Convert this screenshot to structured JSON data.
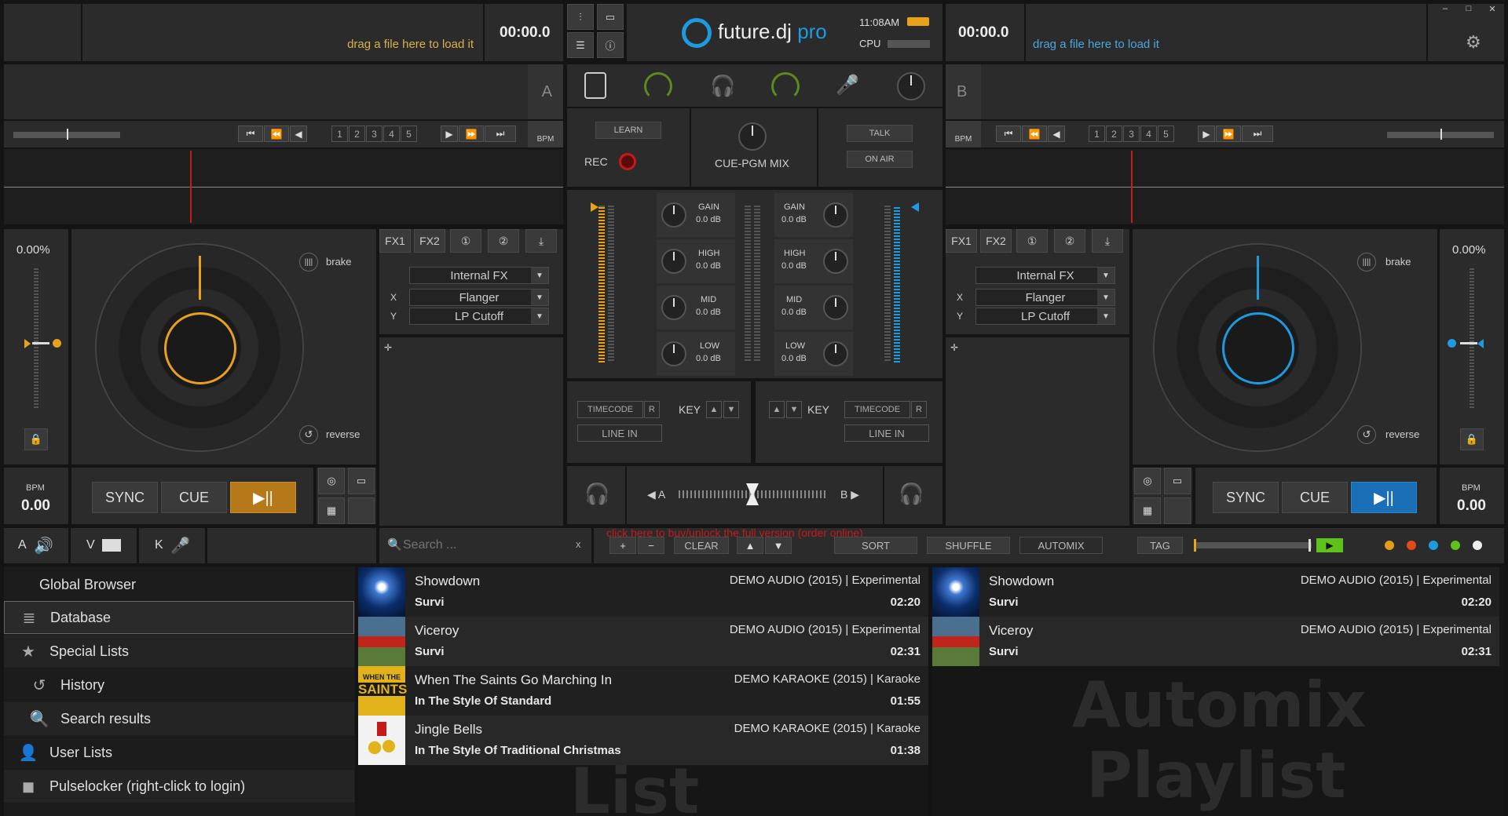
{
  "app": {
    "name": "future.dj",
    "suffix": "pro",
    "clock": "11:08AM",
    "cpu_label": "CPU"
  },
  "window": {
    "minimize": "–",
    "maximize": "□",
    "close": "✕"
  },
  "deckA": {
    "letter": "A",
    "time": "00:00.0",
    "drag_hint": "drag a file here to load it",
    "pitch": "0.00%",
    "bpm_label": "BPM",
    "bpm_value": "0.00",
    "sync": "SYNC",
    "cue": "CUE",
    "play": "▶||",
    "brake": "brake",
    "reverse": "reverse",
    "bpm_btn": "BPM",
    "hotcues": [
      "1",
      "2",
      "3",
      "4",
      "5"
    ],
    "fx1": "FX1",
    "fx2": "FX2",
    "fx_slot": "Internal FX",
    "fx_x_label": "X",
    "fx_x_value": "Flanger",
    "fx_y_label": "Y",
    "fx_y_value": "LP Cutoff",
    "accent": "#e7a21a"
  },
  "deckB": {
    "letter": "B",
    "time": "00:00.0",
    "drag_hint": "drag a file here to load it",
    "pitch": "0.00%",
    "bpm_label": "BPM",
    "bpm_value": "0.00",
    "sync": "SYNC",
    "cue": "CUE",
    "play": "▶||",
    "brake": "brake",
    "reverse": "reverse",
    "bpm_btn": "BPM",
    "hotcues": [
      "1",
      "2",
      "3",
      "4",
      "5"
    ],
    "fx1": "FX1",
    "fx2": "FX2",
    "fx_slot": "Internal FX",
    "fx_x_label": "X",
    "fx_x_value": "Flanger",
    "fx_y_label": "Y",
    "fx_y_value": "LP Cutoff",
    "accent": "#1e9ae0"
  },
  "mixer": {
    "learn": "LEARN",
    "rec": "REC",
    "cue_pgm": "CUE-PGM MIX",
    "talk": "TALK",
    "on_air": "ON AIR",
    "eq_left": [
      {
        "label": "GAIN",
        "value": "0.0 dB"
      },
      {
        "label": "HIGH",
        "value": "0.0 dB"
      },
      {
        "label": "MID",
        "value": "0.0 dB"
      },
      {
        "label": "LOW",
        "value": "0.0 dB"
      }
    ],
    "eq_right": [
      {
        "label": "GAIN",
        "value": "0.0 dB"
      },
      {
        "label": "HIGH",
        "value": "0.0 dB"
      },
      {
        "label": "MID",
        "value": "0.0 dB"
      },
      {
        "label": "LOW",
        "value": "0.0 dB"
      }
    ],
    "timecode": "TIMECODE",
    "r": "R",
    "key": "KEY",
    "line_in": "LINE IN",
    "xfade_a": "◀ A",
    "xfade_b": "B ▶"
  },
  "browser_bar": {
    "tab_a": "A",
    "tab_v": "V",
    "tab_k": "K",
    "search_placeholder": "Search ...",
    "search_clear": "x",
    "plus": "+",
    "minus": "−",
    "clear": "CLEAR",
    "up": "▲",
    "down": "▼",
    "sort": "SORT",
    "shuffle": "SHUFFLE",
    "automix": "AUTOMIX",
    "tag": "TAG",
    "promo": "click here to buy/unlock the full version (order online)",
    "color_dots": [
      "#e79a1a",
      "#e24a1a",
      "#1e9ae0",
      "#5fc21a",
      "#eeeeee"
    ]
  },
  "sidebar": {
    "items": [
      {
        "label": "Global Browser"
      },
      {
        "label": "Database"
      },
      {
        "label": "Special Lists"
      },
      {
        "label": "History"
      },
      {
        "label": "Search results"
      },
      {
        "label": "User Lists"
      },
      {
        "label": "Pulselocker (right-click to login)"
      }
    ]
  },
  "list": {
    "watermark": "List",
    "tracks": [
      {
        "title": "Showdown",
        "artist": "Survi",
        "meta": "DEMO AUDIO (2015) | Experimental",
        "duration": "02:20"
      },
      {
        "title": "Viceroy",
        "artist": "Survi",
        "meta": "DEMO AUDIO (2015) | Experimental",
        "duration": "02:31"
      },
      {
        "title": "When The Saints Go Marching In",
        "artist": "In The Style Of Standard",
        "meta": "DEMO KARAOKE (2015) | Karaoke",
        "duration": "01:55"
      },
      {
        "title": "Jingle Bells",
        "artist": "In The Style Of Traditional Christmas",
        "meta": "DEMO KARAOKE (2015) | Karaoke",
        "duration": "01:38"
      }
    ]
  },
  "automix": {
    "watermark_1": "Automix",
    "watermark_2": "Playlist",
    "tracks": [
      {
        "title": "Showdown",
        "artist": "Survi",
        "meta": "DEMO AUDIO (2015) | Experimental",
        "duration": "02:20"
      },
      {
        "title": "Viceroy",
        "artist": "Survi",
        "meta": "DEMO AUDIO (2015) | Experimental",
        "duration": "02:31"
      }
    ]
  },
  "thumb_text": {
    "saints_1": "WHEN THE",
    "saints_2": "SAINTS"
  }
}
